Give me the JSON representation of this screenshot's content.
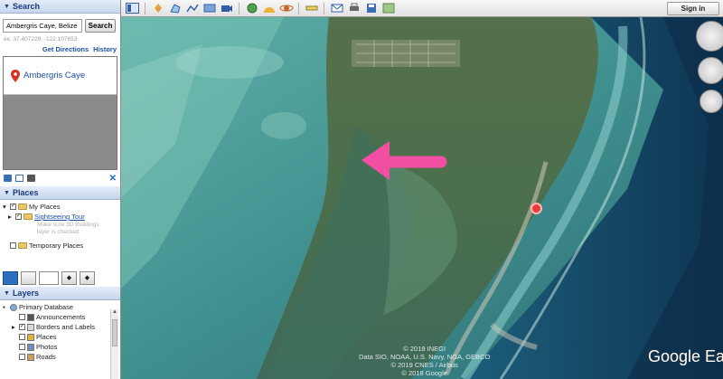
{
  "search": {
    "header": "Search",
    "input_value": "Ambergris Caye, Belize",
    "button_label": "Search",
    "coords": "ex: 37.407229, -122.107653",
    "get_directions": "Get Directions",
    "history": "History",
    "result_label": "Ambergris Caye"
  },
  "places": {
    "header": "Places",
    "my_places": "My Places",
    "sightseeing_tour": "Sightseeing Tour",
    "note_line1": "Make sure 3D Buildings",
    "note_line2": "layer is checked",
    "temporary_places": "Temporary Places"
  },
  "layers": {
    "header": "Layers",
    "items": [
      "Primary Database",
      "Announcements",
      "Borders and Labels",
      "Places",
      "Photos",
      "Roads"
    ]
  },
  "toolbar": {
    "signin": "Sign in",
    "icons": [
      "sidebar-icon",
      "placemark-icon",
      "polygon-icon",
      "path-icon",
      "overlay-icon",
      "record-tour-icon",
      "history-icon",
      "sun-icon",
      "planets-icon",
      "ruler-icon",
      "email-icon",
      "print-icon",
      "save-image-icon",
      "maps-icon"
    ]
  },
  "map": {
    "attribution_line1": "© 2018 INEGI",
    "attribution_line2": "Data SIO, NOAA, U.S. Navy, NGA, GEBCO",
    "attribution_line3": "© 2019 CNES / Airbus",
    "attribution_line4": "© 2018 Google",
    "logo": "Google Ea",
    "arrow_color": "#f24fa3"
  }
}
